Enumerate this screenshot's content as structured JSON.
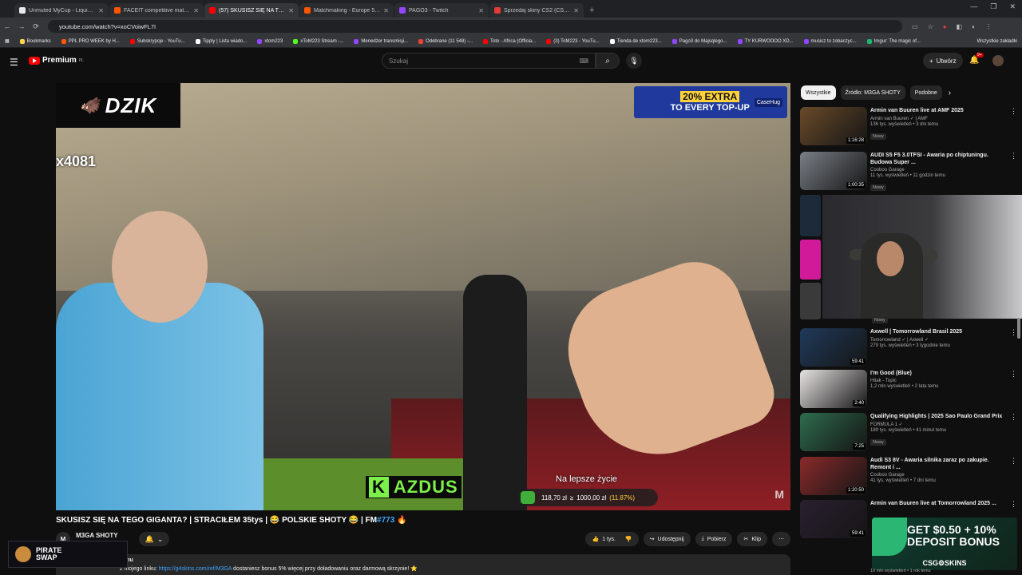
{
  "browser": {
    "tabs": [
      {
        "title": "Unmuted MyCup - Liquipedia",
        "color": "#e8eaed",
        "active": false
      },
      {
        "title": "FACEIT competitive match - Fa",
        "color": "#ff5500",
        "active": false
      },
      {
        "title": "(57) SKUSISZ SIĘ NA TEGO GI",
        "color": "#ff0000",
        "active": true
      },
      {
        "title": "Matchmaking - Europe 5v5 Qu",
        "color": "#ff5500",
        "active": false
      },
      {
        "title": "PAGO3 - Twitch",
        "color": "#9146ff",
        "active": false
      },
      {
        "title": "Sprzedaj skiny CS2 (CSGO) | Ka",
        "color": "#e53935",
        "active": false
      }
    ],
    "new_tab": "+",
    "window_controls": [
      "—",
      "❐",
      "✕"
    ],
    "url": "youtube.com/watch?v=xoCVoiwFL7I",
    "bookmarks": [
      {
        "label": "Bookmarks",
        "color": "#ffd54f"
      },
      {
        "label": "PPL PRO WEEK by H...",
        "color": "#ff5500"
      },
      {
        "label": "Subskrypcje - YouTu...",
        "color": "#ff0000"
      },
      {
        "label": "Tipply | Lista wiado...",
        "color": "#ffffff"
      },
      {
        "label": "xtom223",
        "color": "#9146ff"
      },
      {
        "label": "xToM223 Stream -...",
        "color": "#53fc18"
      },
      {
        "label": "Menedżer transmisji...",
        "color": "#9146ff"
      },
      {
        "label": "Odebrane (11 548) -...",
        "color": "#ea4335"
      },
      {
        "label": "Toto - Africa (Officia...",
        "color": "#ff0000"
      },
      {
        "label": "(3) ToM223 - YouTu...",
        "color": "#ff0000"
      },
      {
        "label": "Tienda de xtom223...",
        "color": "#ffffff"
      },
      {
        "label": "Pago3 do Majsqlego...",
        "color": "#9146ff"
      },
      {
        "label": "TY KURWOOOO XD...",
        "color": "#9146ff"
      },
      {
        "label": "musisz to zobaczyc...",
        "color": "#9146ff"
      },
      {
        "label": "Imgur: The magic of...",
        "color": "#1bb76e"
      }
    ],
    "all_bookmarks": "Wszystkie zakładki"
  },
  "header": {
    "logo_text": "Premium",
    "logo_sup": "PL",
    "search_placeholder": "Szukaj",
    "create_label": "Utwórz",
    "notif_count": "9+"
  },
  "video": {
    "overlay_logo": "DZIK",
    "counter": "x4081",
    "promo_line1": "20% EXTRA",
    "promo_line2": "TO EVERY TOP-UP",
    "promo_brand": "CaseHug",
    "caption_k": "K",
    "caption_rest": "AZDUS",
    "subtitle": "Na lepsze życie",
    "money_left": "118,70 zł",
    "money_sep": "≥",
    "money_right": "1000,00 zł",
    "money_pct": "(11.87%)",
    "watermark": "M",
    "title": "SKUSISZ SIĘ NA TEGO GIGANTA? | STRACIŁEM 35tys | 😂 POLSKIE SHOTY 😂 | FM",
    "title_tag": "#773",
    "title_emoji": "🔥"
  },
  "channel": {
    "avatar_text": "M",
    "name": "M3GA SHOTY",
    "likes": "1 tys.",
    "share": "Udostępnij",
    "download": "Pobierz",
    "clip": "Klip",
    "more": "⋯"
  },
  "description": {
    "meta": "temu",
    "text_prefix": "z mojego linku:",
    "link": "https://g4skins.com/ref/M3GA",
    "text_suffix": "dostaniesz bonus 5% więcej przy doładowaniu oraz darmową skrzynie! ⭐"
  },
  "pirate_ad": {
    "line1": "PIRATE",
    "line2": "SWAP"
  },
  "sidebar": {
    "chips": [
      {
        "label": "Wszystkie",
        "active": true
      },
      {
        "label": "Źródło: M3GA SHOTY",
        "active": false
      },
      {
        "label": "Podobne",
        "active": false
      }
    ],
    "recs": [
      {
        "title": "Armin van Buuren live at AMF 2025",
        "channel": "Armin van Buuren ✓ | AMF",
        "meta": "136 tys. wyświetleń • 3 dni temu",
        "badge": "Nowy",
        "duration": "1:16:28",
        "color": "#6a4a2a"
      },
      {
        "title": "AUDI S5 F5 3.0TFSI - Awaria po chiptuningu. Budowa Super ...",
        "channel": "Cooboo Garage",
        "meta": "11 tys. wyświetleń • 11 godzin temu",
        "badge": "Nowy",
        "duration": "1:00:35",
        "color": "#7a7f86"
      },
      {
        "title": "Axwell | Tomorrowland Brasil 2025",
        "channel": "Tomorrowland ✓ | Axwell ✓",
        "meta": "279 tys. wyświetleń • 3 tygodnie temu",
        "badge": "",
        "duration": "59:41",
        "color": "#203a5a"
      },
      {
        "title": "I'm Good (Blue)",
        "channel": "Hitak - Topic",
        "meta": "1,2 mln wyświetleń • 2 lata temu",
        "badge": "",
        "duration": "2:40",
        "color": "#e8e4e4"
      },
      {
        "title": "Qualifying Highlights | 2025 Sao Paulo Grand Prix",
        "channel": "FORMULA 1 ✓",
        "meta": "189 tys. wyświetleń • 41 minut temu",
        "badge": "Nowy",
        "duration": "7:25",
        "color": "#2e6b4e"
      },
      {
        "title": "Audi S3 8V - Awaria silnika zaraz po zakupie. Remont i ...",
        "channel": "Cooboo Garage",
        "meta": "41 tys. wyświetleń • 7 dni temu",
        "badge": "",
        "duration": "1:20:50",
        "color": "#8a2a2a"
      },
      {
        "title": "Armin van Buuren live at Tomorrowland 2025 ...",
        "channel": "",
        "meta": "",
        "badge": "",
        "duration": "59:41",
        "color": "#2a2030"
      }
    ],
    "covered_badge": "Nowy",
    "ad_line1": "GET $0.50 + 10%",
    "ad_line2": "DEPOSIT BONUS",
    "ad_brand": "CSG⚙SKINS",
    "ad_under": "10 mln wyświetleń • 1 rok temu"
  }
}
